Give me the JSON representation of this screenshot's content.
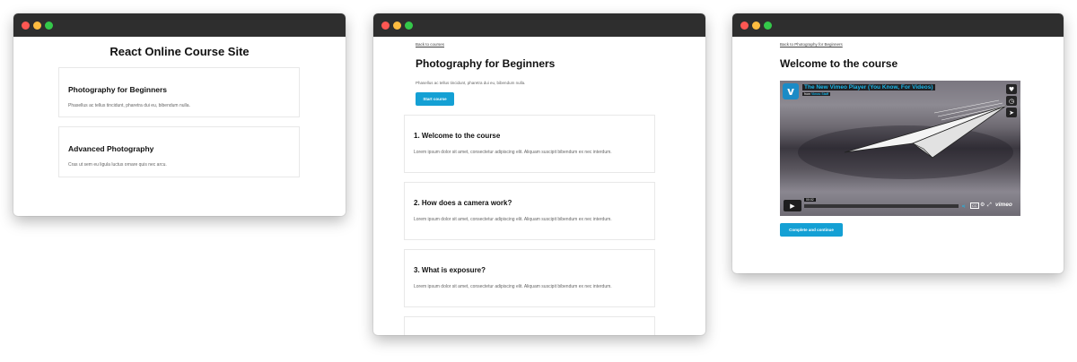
{
  "window1": {
    "site_title": "React Online Course Site",
    "courses": [
      {
        "title": "Photography for Beginners",
        "description": "Phasellus ac tellus tincidunt, pharetra dui eu, bibendum nulla."
      },
      {
        "title": "Advanced Photography",
        "description": "Cras ut sem eu ligula luctus ornare quis nec arcu."
      }
    ]
  },
  "window2": {
    "back_link": "Back to courses",
    "title": "Photography for Beginners",
    "description": "Phasellus ac tellus tincidunt, pharetra dui eu, bibendum nulla.",
    "start_button": "Start course",
    "lessons": [
      {
        "title": "1. Welcome to the course",
        "body": "Lorem ipsum dolor sit amet, consectetur adipiscing elit. Aliquam suscipit bibendum ex nec interdum."
      },
      {
        "title": "2. How does a camera work?",
        "body": "Lorem ipsum dolor sit amet, consectetur adipiscing elit. Aliquam suscipit bibendum ex nec interdum."
      },
      {
        "title": "3. What is exposure?",
        "body": "Lorem ipsum dolor sit amet, consectetur adipiscing elit. Aliquam suscipit bibendum ex nec interdum."
      }
    ]
  },
  "window3": {
    "back_link": "Back to Photography for Beginners",
    "title": "Welcome to the course",
    "video": {
      "title": "The New Vimeo Player (You Know, For Videos)",
      "from_label": "from",
      "from_author": "Vimeo Staff",
      "timecode": "00:02",
      "brand": "vimeo",
      "cc_label": "CC",
      "logo_letter": "v"
    },
    "complete_button": "Complete and continue"
  },
  "colors": {
    "titlebar": "#2e2e2e",
    "accent_button": "#14a0d4",
    "vimeo_blue": "#1ab7ea",
    "traffic_red": "#fc5753",
    "traffic_yellow": "#fdbc40",
    "traffic_green": "#34c84a"
  },
  "icons": {
    "heart": "heart-icon",
    "clock": "clock-icon",
    "share": "share-icon",
    "play": "play-icon",
    "settings": "gear-icon",
    "fullscreen": "fullscreen-icon",
    "volume": "volume-icon"
  }
}
